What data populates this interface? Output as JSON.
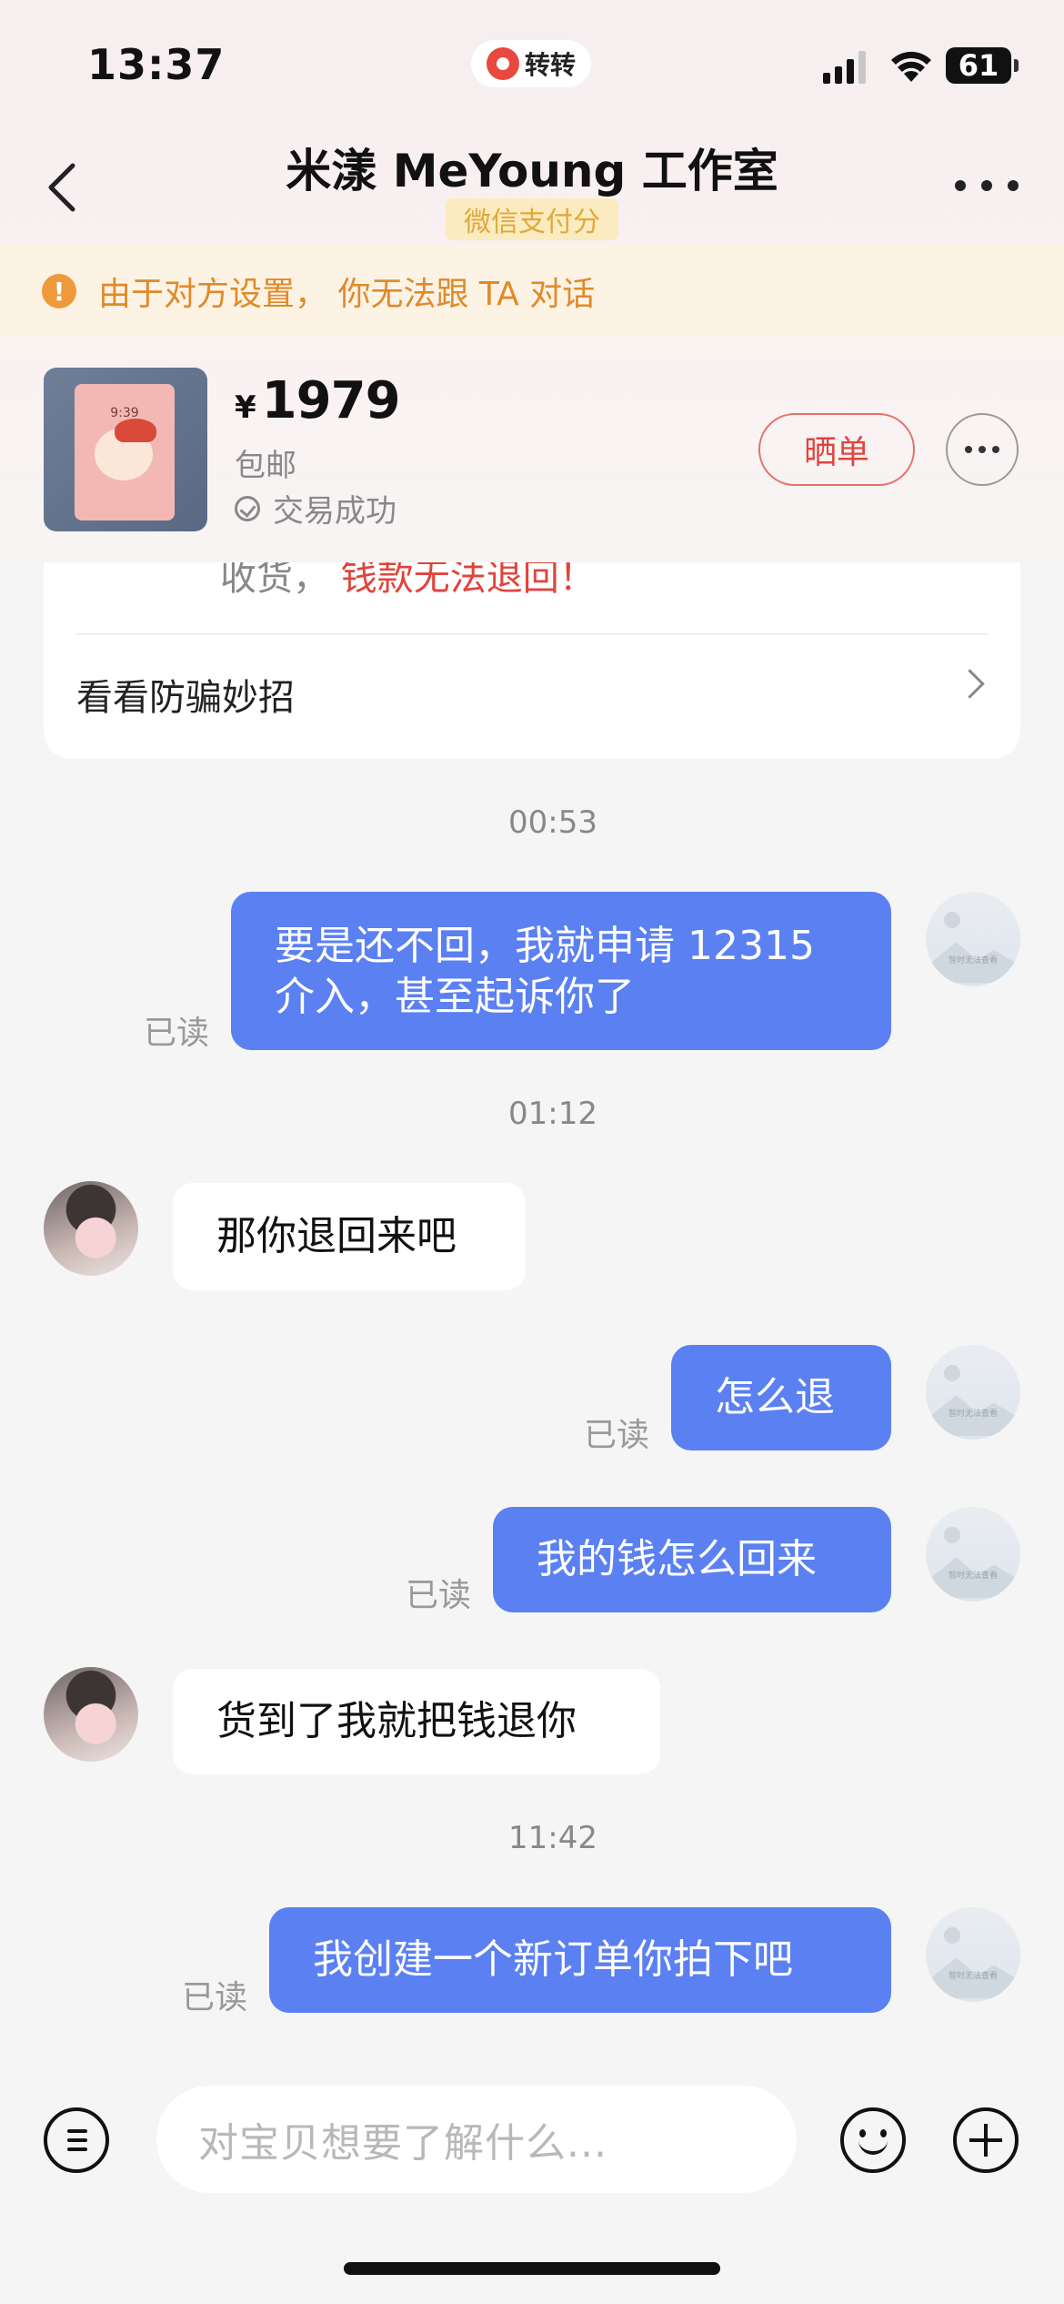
{
  "status_bar": {
    "time": "13:37",
    "app_badge": "转转",
    "battery": "61"
  },
  "header": {
    "title": "米漾 MeYoung 工作室",
    "subtitle": "微信支付分"
  },
  "notice": {
    "icon": "!",
    "text": "由于对方设置， 你无法跟 TA 对话"
  },
  "order": {
    "currency": "¥",
    "price": "1979",
    "shipping": "包邮",
    "status": "交易成功",
    "thumb_time": "9:39",
    "share_label": "晒单"
  },
  "tip": {
    "partial_prefix": "收货，",
    "partial_warning": "钱款无法退回！",
    "link": "看看防骗妙招"
  },
  "self_avatar_caption": "暂时无法查看",
  "messages": {
    "ts1": "00:53",
    "m1": "要是还不回，我就申请 12315 介入，甚至起诉你了",
    "m1_read": "已读",
    "ts2": "01:12",
    "m2": "那你退回来吧",
    "m3": "怎么退",
    "m3_read": "已读",
    "m4": "我的钱怎么回来",
    "m4_read": "已读",
    "m5": "货到了我就把钱退你",
    "ts3": "11:42",
    "m6": "我创建一个新订单你拍下吧",
    "m6_read": "已读"
  },
  "composer": {
    "placeholder": "对宝贝想要了解什么..."
  },
  "colors": {
    "outgoing_bubble": "#5b80f2",
    "accent_red": "#e0443c",
    "notice_orange": "#e08a2a"
  }
}
